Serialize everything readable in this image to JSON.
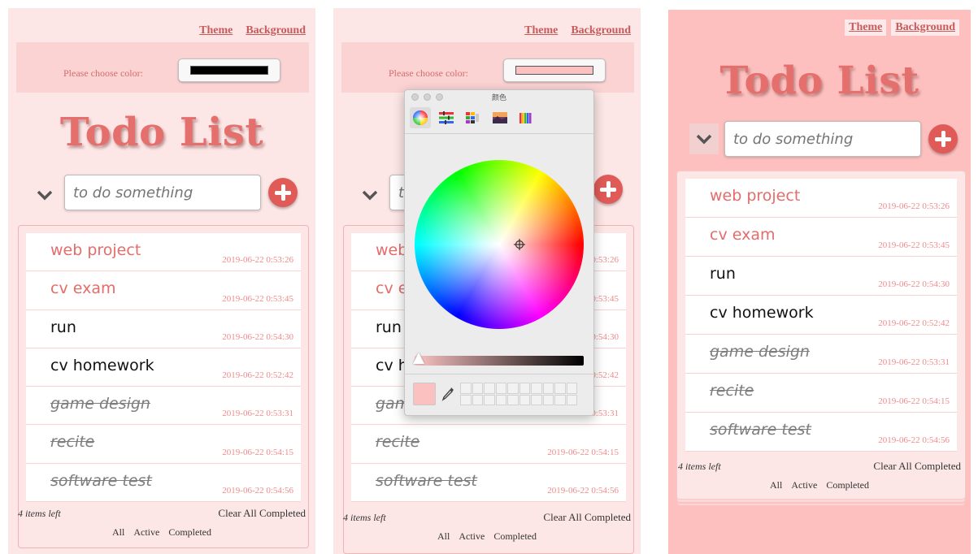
{
  "nav": {
    "theme": "Theme",
    "background": "Background"
  },
  "color_label": "Please choose color:",
  "colors": {
    "accent": "#e46f6d",
    "panel_bg": "#fde6e6",
    "panel_bg_pink": "#fdc0bf",
    "timestamp": "#f08b89"
  },
  "app_title": "Todo List",
  "input_placeholder": "to do something",
  "items": [
    {
      "text": "web project",
      "time": "2019-06-22 0:53:26",
      "state": "active"
    },
    {
      "text": "cv exam",
      "time": "2019-06-22 0:53:45",
      "state": "active"
    },
    {
      "text": "run",
      "time": "2019-06-22 0:54:30",
      "state": "active"
    },
    {
      "text": "cv homework",
      "time": "2019-06-22 0:52:42",
      "state": "active"
    },
    {
      "text": "game design",
      "time": "2019-06-22 0:53:31",
      "state": "completed"
    },
    {
      "text": "recite",
      "time": "2019-06-22 0:54:15",
      "state": "completed"
    },
    {
      "text": "software test",
      "time": "2019-06-22 0:54:56",
      "state": "completed"
    }
  ],
  "footer": {
    "items_left": "4 items left",
    "clear_completed": "Clear All Completed",
    "filters": [
      "All",
      "Active",
      "Completed"
    ]
  },
  "picker": {
    "title": "颜色",
    "tabs": [
      "color-wheel-icon",
      "color-sliders-icon",
      "color-palettes-icon",
      "image-palettes-icon",
      "crayons-icon"
    ]
  }
}
